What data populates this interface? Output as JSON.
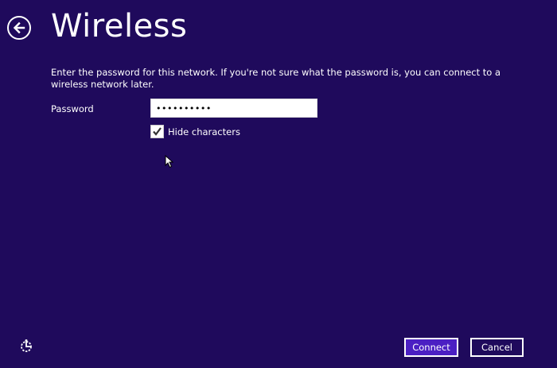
{
  "header": {
    "back_icon": "arrow-left-icon",
    "title": "Wireless"
  },
  "form": {
    "instructions": "Enter the password for this network. If you're not sure what the password is, you can connect to a wireless network later.",
    "password_label": "Password",
    "password_value": "••••••••••",
    "hide_characters_label": "Hide characters",
    "hide_characters_checked": true
  },
  "footer": {
    "accessibility_icon": "ease-of-access-icon",
    "connect_label": "Connect",
    "cancel_label": "Cancel"
  },
  "colors": {
    "background": "#1f0a5c",
    "primary_button": "#4b1fc3",
    "text": "#ffffff"
  }
}
